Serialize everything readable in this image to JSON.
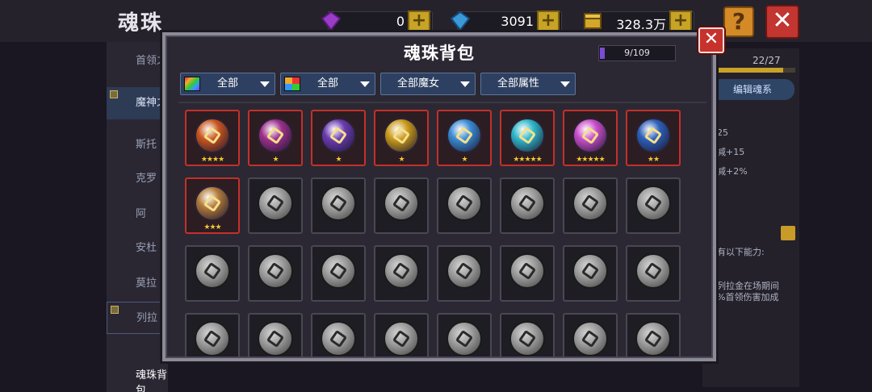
{
  "background": {
    "title": "魂珠",
    "currencies": [
      {
        "icon": "purple-gem-icon",
        "value": "0"
      },
      {
        "icon": "blue-gem-icon",
        "value": "3091"
      },
      {
        "icon": "gold-chest-icon",
        "value": "328.3万"
      }
    ],
    "help_label": "?",
    "close_label": "✕",
    "sidebar": {
      "items": [
        {
          "label": "首领之"
        },
        {
          "label": "魔神之"
        },
        {
          "label": "斯托"
        },
        {
          "label": "克罗"
        },
        {
          "label": "阿"
        },
        {
          "label": "安杜"
        },
        {
          "label": "莫拉"
        },
        {
          "label": "列拉"
        }
      ],
      "bottom_label": "魂珠背包"
    },
    "right_panel": {
      "count": "22/27",
      "edit_label": "编辑魂系",
      "lines": [
        "25",
        "减+15",
        "减+2%",
        "有以下能力:",
        "列拉金在场期间",
        "%首领伤害加成"
      ]
    }
  },
  "modal": {
    "title": "魂珠背包",
    "capacity": "9/109",
    "close_label": "✕",
    "filters": [
      {
        "label": "全部",
        "icon": "rainbow-square-icon"
      },
      {
        "label": "全部",
        "icon": "quad-color-icon"
      },
      {
        "label": "全部魔女",
        "icon": ""
      },
      {
        "label": "全部属性",
        "icon": ""
      }
    ]
  },
  "orbs": [
    {
      "name": "flame-sword-orb-icon",
      "stars": "★★★★",
      "owned": true,
      "color": "#c8551e"
    },
    {
      "name": "purple-sigil-orb-icon",
      "stars": "★",
      "owned": true,
      "color": "#9c2f8a"
    },
    {
      "name": "violet-bat-orb-icon",
      "stars": "★",
      "owned": true,
      "color": "#6a3bb0"
    },
    {
      "name": "golden-mask-orb-icon",
      "stars": "★",
      "owned": true,
      "color": "#c99a1a"
    },
    {
      "name": "ice-crystal-orb-icon",
      "stars": "★",
      "owned": true,
      "color": "#3a8ad1"
    },
    {
      "name": "cyan-sphere-orb-icon",
      "stars": "★★★★★",
      "owned": true,
      "color": "#2fb6c9"
    },
    {
      "name": "pink-sphere-orb-icon",
      "stars": "★★★★★",
      "owned": true,
      "color": "#c94ec9"
    },
    {
      "name": "blue-cannon-orb-icon",
      "stars": "★★",
      "owned": true,
      "color": "#2d5fb8"
    },
    {
      "name": "skull-lantern-orb-icon",
      "stars": "★★★",
      "owned": true,
      "color": "#b07a3a"
    },
    {
      "name": "locked-orb-icon",
      "stars": "",
      "owned": false
    },
    {
      "name": "locked-orb-icon",
      "stars": "",
      "owned": false
    },
    {
      "name": "locked-orb-icon",
      "stars": "",
      "owned": false
    },
    {
      "name": "locked-orb-icon",
      "stars": "",
      "owned": false
    },
    {
      "name": "locked-orb-icon",
      "stars": "",
      "owned": false
    },
    {
      "name": "locked-orb-icon",
      "stars": "",
      "owned": false
    },
    {
      "name": "locked-orb-icon",
      "stars": "",
      "owned": false
    },
    {
      "name": "locked-orb-icon",
      "stars": "",
      "owned": false
    },
    {
      "name": "locked-orb-icon",
      "stars": "",
      "owned": false
    },
    {
      "name": "locked-orb-icon",
      "stars": "",
      "owned": false
    },
    {
      "name": "locked-orb-icon",
      "stars": "",
      "owned": false
    },
    {
      "name": "locked-orb-icon",
      "stars": "",
      "owned": false
    },
    {
      "name": "locked-orb-icon",
      "stars": "",
      "owned": false
    },
    {
      "name": "locked-orb-icon",
      "stars": "",
      "owned": false
    },
    {
      "name": "locked-orb-icon",
      "stars": "",
      "owned": false
    },
    {
      "name": "locked-orb-icon",
      "stars": "",
      "owned": false
    },
    {
      "name": "locked-orb-icon",
      "stars": "",
      "owned": false
    },
    {
      "name": "locked-orb-icon",
      "stars": "",
      "owned": false
    },
    {
      "name": "locked-orb-icon",
      "stars": "",
      "owned": false
    },
    {
      "name": "locked-orb-icon",
      "stars": "",
      "owned": false
    },
    {
      "name": "locked-orb-icon",
      "stars": "",
      "owned": false
    },
    {
      "name": "locked-orb-icon",
      "stars": "",
      "owned": false
    },
    {
      "name": "locked-orb-icon",
      "stars": "",
      "owned": false
    }
  ]
}
